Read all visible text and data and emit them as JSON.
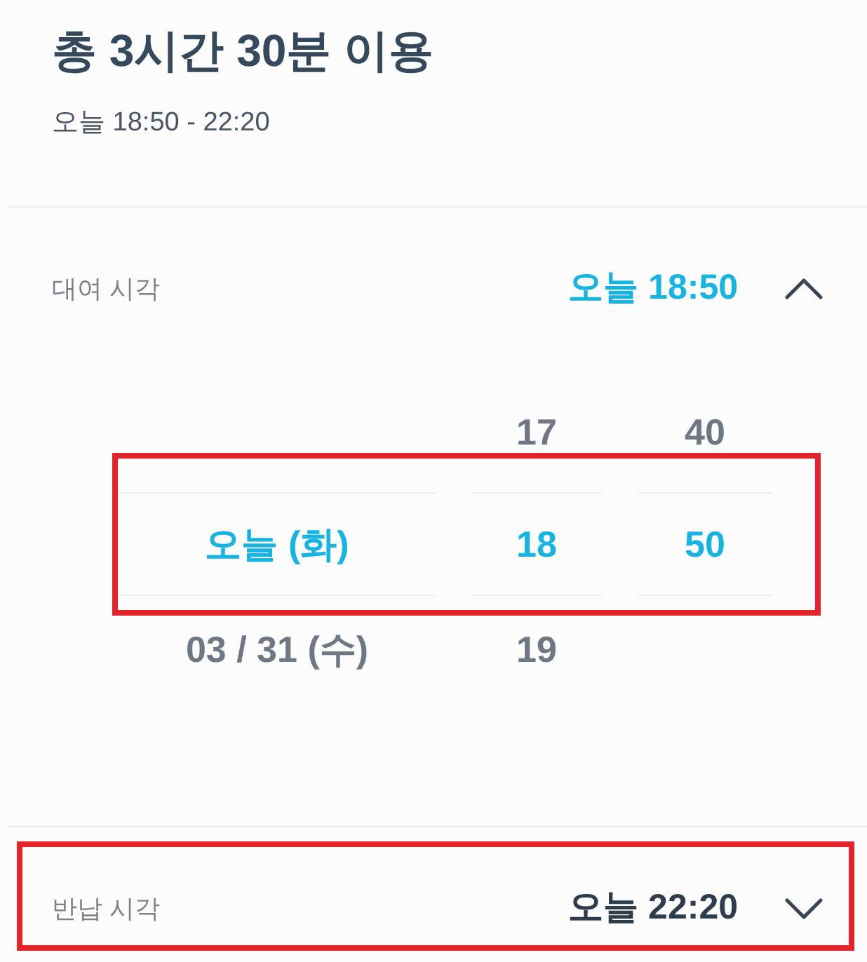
{
  "summary": {
    "title": "총 3시간 30분 이용",
    "range": "오늘 18:50 - 22:20"
  },
  "sections": [
    {
      "label": "대여 시각",
      "value": "오늘 18:50",
      "expanded": true,
      "highlighted": false,
      "picker": {
        "highlighted": true,
        "columns": [
          {
            "items": [
              {
                "text": "오늘 (화)",
                "selected": true
              },
              {
                "text": "03 / 31 (수)",
                "selected": false
              }
            ]
          },
          {
            "items": [
              {
                "text": "17",
                "selected": false
              },
              {
                "text": "18",
                "selected": true
              },
              {
                "text": "19",
                "selected": false
              }
            ]
          },
          {
            "items": [
              {
                "text": "40",
                "selected": false
              },
              {
                "text": "50",
                "selected": true
              }
            ]
          }
        ]
      }
    },
    {
      "label": "반납 시각",
      "value": "오늘 22:20",
      "expanded": false,
      "highlighted": true
    }
  ]
}
